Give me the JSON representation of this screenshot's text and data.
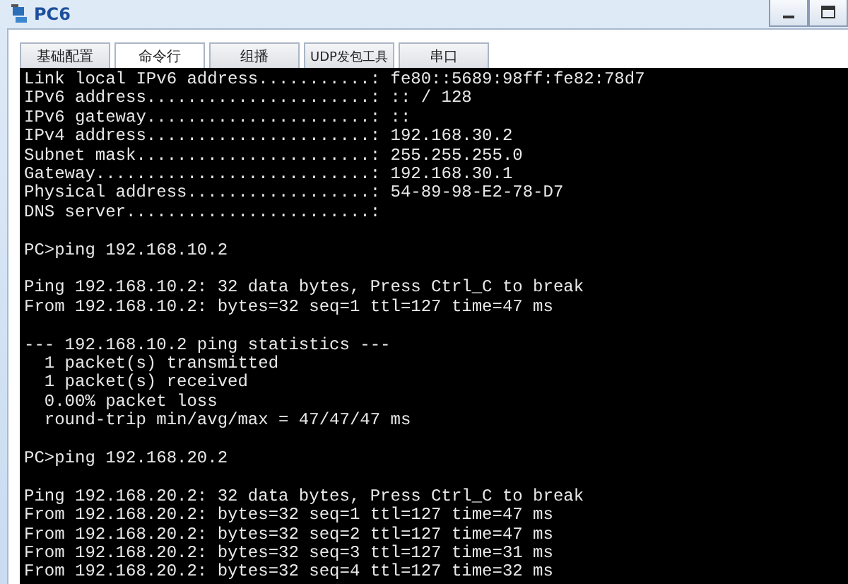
{
  "window": {
    "title": "PC6"
  },
  "tabs": [
    {
      "label": "基础配置",
      "selected": false
    },
    {
      "label": "命令行",
      "selected": true
    },
    {
      "label": "组播",
      "selected": false
    },
    {
      "label": "UDP发包工具",
      "selected": false
    },
    {
      "label": "串口",
      "selected": false
    }
  ],
  "terminal": {
    "blocks": [
      [
        "Link local IPv6 address...........: fe80::5689:98ff:fe82:78d7",
        "IPv6 address......................: :: / 128",
        "IPv6 gateway......................: ::",
        "IPv4 address......................: 192.168.30.2",
        "Subnet mask.......................: 255.255.255.0",
        "Gateway...........................: 192.168.30.1",
        "Physical address..................: 54-89-98-E2-78-D7",
        "DNS server........................:"
      ],
      [
        "PC>ping 192.168.10.2"
      ],
      [
        "Ping 192.168.10.2: 32 data bytes, Press Ctrl_C to break",
        "From 192.168.10.2: bytes=32 seq=1 ttl=127 time=47 ms"
      ],
      [
        "--- 192.168.10.2 ping statistics ---",
        "  1 packet(s) transmitted",
        "  1 packet(s) received",
        "  0.00% packet loss",
        "  round-trip min/avg/max = 47/47/47 ms"
      ],
      [
        "PC>ping 192.168.20.2"
      ],
      [
        "Ping 192.168.20.2: 32 data bytes, Press Ctrl_C to break",
        "From 192.168.20.2: bytes=32 seq=1 ttl=127 time=47 ms",
        "From 192.168.20.2: bytes=32 seq=2 ttl=127 time=47 ms",
        "From 192.168.20.2: bytes=32 seq=3 ttl=127 time=31 ms",
        "From 192.168.20.2: bytes=32 seq=4 ttl=127 time=32 ms"
      ]
    ]
  }
}
